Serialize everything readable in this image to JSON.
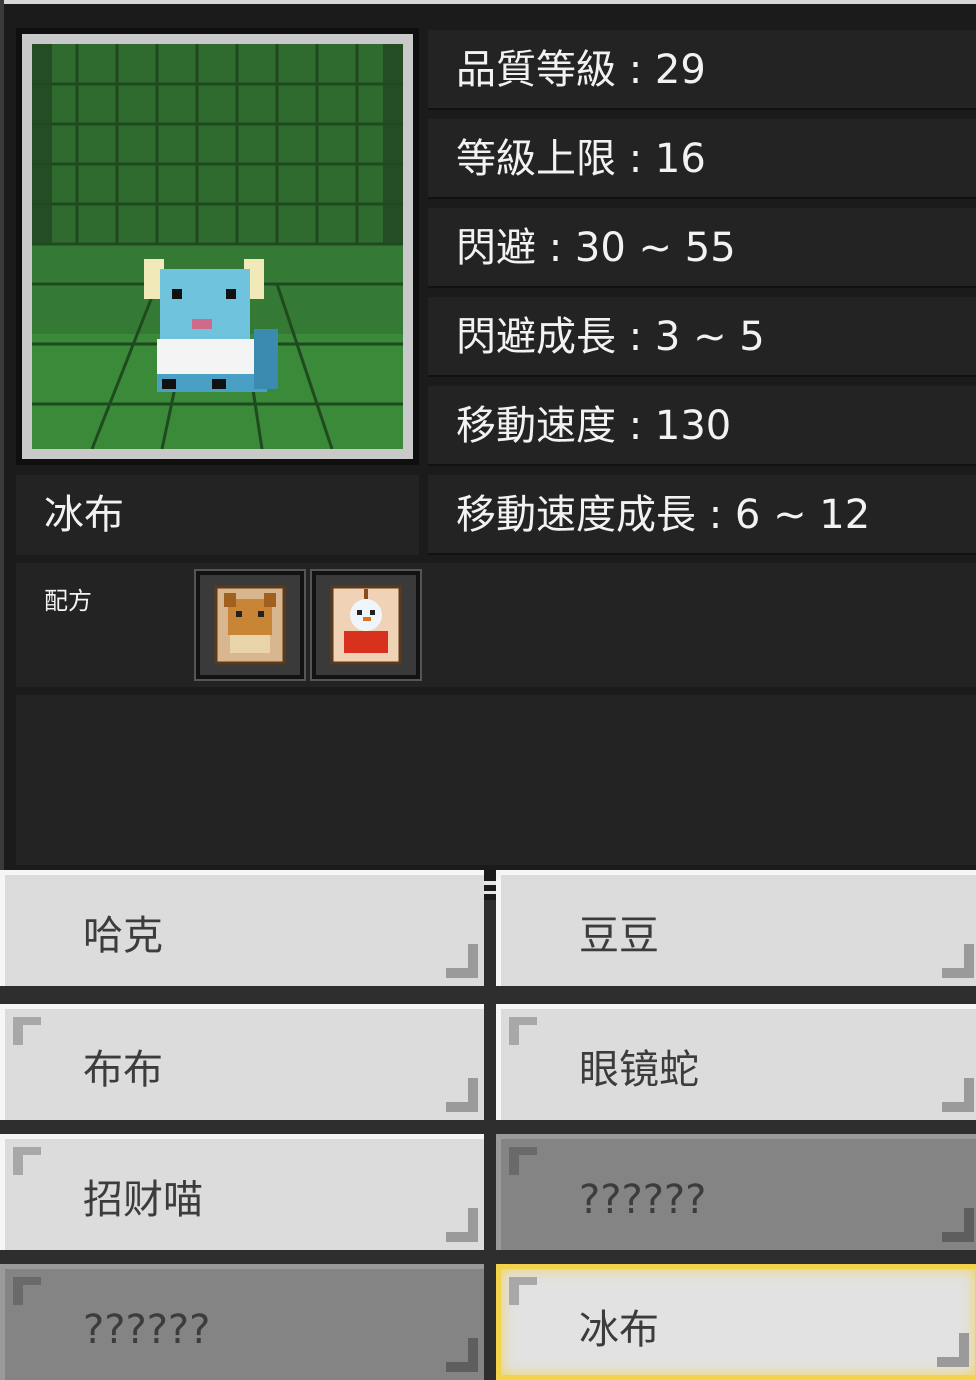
{
  "detail": {
    "name": "冰布",
    "recipe_label": "配方",
    "stats": [
      {
        "label": "品質等級 : 29"
      },
      {
        "label": "等級上限 : 16"
      },
      {
        "label": "閃避 : 30 ~ 55"
      },
      {
        "label": "閃避成長 : 3 ~ 5"
      },
      {
        "label": "移動速度 : 130"
      },
      {
        "label": "移動速度成長 : 6 ~ 12"
      }
    ],
    "recipe_items": [
      "eevee-card-icon",
      "snowman-card-icon"
    ]
  },
  "list": [
    {
      "label": "哈克",
      "locked": false,
      "selected": false
    },
    {
      "label": "豆豆",
      "locked": false,
      "selected": false
    },
    {
      "label": "布布",
      "locked": false,
      "selected": false
    },
    {
      "label": "眼镜蛇",
      "locked": false,
      "selected": false
    },
    {
      "label": "招财喵",
      "locked": false,
      "selected": false
    },
    {
      "label": "??????",
      "locked": true,
      "selected": false
    },
    {
      "label": "??????",
      "locked": true,
      "selected": false
    },
    {
      "label": "冰布",
      "locked": false,
      "selected": true
    }
  ],
  "colors": {
    "panel_bg": "#1b1b1b",
    "box_bg": "#232323",
    "cell_bg": "#dcdcdc",
    "locked_bg": "#848484",
    "selected_border": "#f3d24c"
  }
}
